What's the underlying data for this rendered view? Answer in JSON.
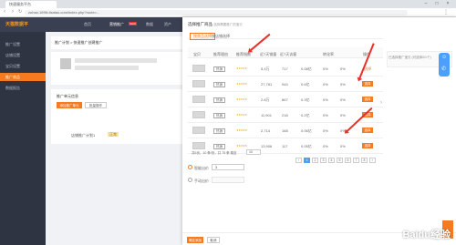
{
  "browser": {
    "tab_title": "快速服务平台",
    "url": "zuhao.169lk.lisatao.com/index.php?route=..."
  },
  "app": {
    "logo_text": "天猫数据平",
    "nav": [
      "首页",
      "营销推广",
      "数据",
      "资产",
      "报告"
    ],
    "nav_badge": "NEW"
  },
  "sidebar": {
    "items": [
      {
        "label": "推广设置",
        "active": false
      },
      {
        "label": "店铺设置",
        "active": false
      },
      {
        "label": "宝贝设置",
        "active": false
      },
      {
        "label": "推广商品",
        "active": true
      },
      {
        "label": "数据报告",
        "active": false
      }
    ]
  },
  "main": {
    "breadcrumb": "推广计划 > 快速推广创建推广",
    "section_label": "推广单元信息",
    "add_button": "添加推广单元",
    "batch_button": "批量操作",
    "row_label": "店铺推广计划1",
    "row_tag": "正常"
  },
  "modal": {
    "title": "选择推广商品",
    "subtitle": "选择需要推广的宝贝",
    "tabs": [
      "按商品选择",
      "按店铺选择"
    ],
    "columns": [
      "宝贝",
      "推荐理由",
      "推荐指数",
      "近7天销量",
      "近7天访客",
      "转化率",
      "操作"
    ],
    "rows": [
      {
        "tag": "热销",
        "sales": "5,4万",
        "visitors": "717",
        "amount": "0.08亿",
        "rate": "0%",
        "action": "选择"
      },
      {
        "tag": "热销",
        "sales": "27,781",
        "visitors": "944",
        "amount": "0.6亿",
        "rate": "0%",
        "action": "选择"
      },
      {
        "tag": "热销",
        "sales": "2.8万",
        "visitors": "867",
        "amount": "0.3亿",
        "rate": "0%",
        "action": "选择"
      },
      {
        "tag": "热销",
        "sales": "11,901",
        "visitors": "218",
        "amount": "0.2亿",
        "rate": "0%",
        "action": "选择"
      },
      {
        "tag": "热销",
        "sales": "2,714",
        "visitors": "168",
        "amount": "0.06亿",
        "rate": "0%",
        "action": "选择"
      },
      {
        "tag": "热销",
        "sales": "13,906",
        "visitors": "117",
        "amount": "0.05亿",
        "rate": "0%",
        "action": "选择"
      }
    ],
    "side_note": "已选择推广宝贝 (可选择0/1个)",
    "pagination_text": "共6页，10 条/页，共 75 条 跳至",
    "per_page": "10",
    "pages": [
      "1",
      "2",
      "3",
      "4",
      "5",
      "6",
      "7",
      "8"
    ],
    "current_page": "1",
    "option1_label": "智能出价",
    "option1_value": "3",
    "option2_label": "手动出价",
    "confirm_button": "确定添加",
    "cancel_button": "取消"
  },
  "right_panel": {
    "icons": [
      "person-icon",
      "phone-icon"
    ]
  },
  "watermark": "Baidu经验",
  "colors": {
    "accent": "#f57b20",
    "nav_bg": "#3a3f51",
    "sidebar_bg": "#2f3443",
    "annotation": "#e8312a",
    "link": "#4aa0ff"
  }
}
